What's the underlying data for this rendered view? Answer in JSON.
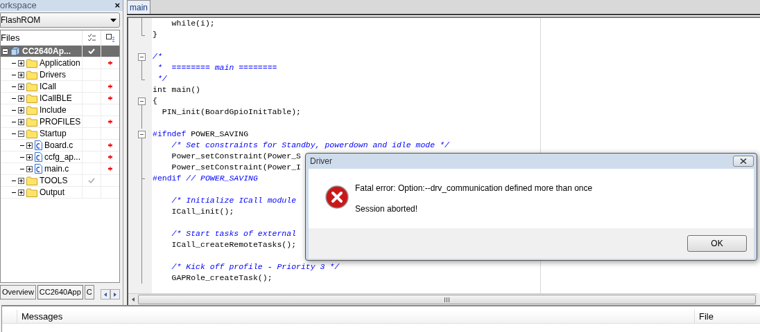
{
  "workspace": {
    "title": "orkspace",
    "close": "×",
    "configuration": "FlashROM",
    "columns": [
      "Files"
    ],
    "tree": [
      {
        "name": "CC2640Ap...",
        "kind": "project",
        "selected": true,
        "expanded": true,
        "check": true,
        "modified": false,
        "children": [
          {
            "name": "Application",
            "kind": "folder",
            "selected": false,
            "expanded": false,
            "check": false,
            "modified": true
          },
          {
            "name": "Drivers",
            "kind": "folder",
            "selected": false,
            "expanded": false,
            "check": false,
            "modified": false
          },
          {
            "name": "ICall",
            "kind": "folder",
            "selected": false,
            "expanded": false,
            "check": false,
            "modified": true
          },
          {
            "name": "ICallBLE",
            "kind": "folder",
            "selected": false,
            "expanded": false,
            "check": false,
            "modified": true
          },
          {
            "name": "Include",
            "kind": "folder",
            "selected": false,
            "expanded": false,
            "check": false,
            "modified": false
          },
          {
            "name": "PROFILES",
            "kind": "folder",
            "selected": false,
            "expanded": false,
            "check": false,
            "modified": true
          },
          {
            "name": "Startup",
            "kind": "folder",
            "selected": false,
            "expanded": true,
            "check": false,
            "modified": false,
            "children": [
              {
                "name": "Board.c",
                "kind": "file",
                "selected": false,
                "expanded": false,
                "check": false,
                "modified": true
              },
              {
                "name": "ccfg_ap...",
                "kind": "file",
                "selected": false,
                "expanded": false,
                "check": false,
                "modified": true
              },
              {
                "name": "main.c",
                "kind": "file",
                "selected": false,
                "expanded": false,
                "check": false,
                "modified": true
              }
            ]
          },
          {
            "name": "TOOLS",
            "kind": "folder",
            "selected": false,
            "expanded": false,
            "check": true,
            "modified": false
          },
          {
            "name": "Output",
            "kind": "folder",
            "selected": false,
            "expanded": false,
            "check": false,
            "modified": false
          }
        ]
      }
    ],
    "tabs": [
      {
        "label": "Overview",
        "selected": false
      },
      {
        "label": "CC2640App",
        "selected": true
      },
      {
        "label": "C",
        "selected": false
      }
    ]
  },
  "editor": {
    "tabs": [
      {
        "label": "main",
        "selected": true
      }
    ],
    "lines": [
      {
        "kind": "bar",
        "segments": [
          {
            "kind": "plain",
            "text": "    while(i);"
          }
        ]
      },
      {
        "kind": "end",
        "segments": [
          {
            "kind": "plain",
            "text": "}"
          }
        ]
      },
      {
        "kind": "none"
      },
      {
        "kind": "start",
        "segments": [
          {
            "kind": "comment",
            "text": "/*"
          }
        ]
      },
      {
        "kind": "bar",
        "segments": [
          {
            "kind": "comment",
            "text": " *  ======== main ========"
          }
        ]
      },
      {
        "kind": "end",
        "segments": [
          {
            "kind": "comment",
            "text": " */"
          }
        ]
      },
      {
        "kind": "none",
        "segments": [
          {
            "kind": "plain",
            "text": "int main()"
          }
        ]
      },
      {
        "kind": "start",
        "segments": [
          {
            "kind": "plain",
            "text": "{"
          }
        ]
      },
      {
        "kind": "bar",
        "segments": [
          {
            "kind": "plain",
            "text": "  PIN_init(BoardGpioInitTable);"
          }
        ]
      },
      {
        "kind": "bar"
      },
      {
        "kind": "start",
        "segments": [
          {
            "kind": "keyword",
            "text": "#ifndef"
          },
          {
            "kind": "plain",
            "text": " POWER_SAVING"
          }
        ]
      },
      {
        "kind": "bar",
        "segments": [
          {
            "kind": "comment",
            "text": "    /* Set constraints for Standby, powerdown and idle mode */"
          }
        ]
      },
      {
        "kind": "bar",
        "segments": [
          {
            "kind": "plain",
            "text": "    Power_setConstraint(Power_S"
          }
        ]
      },
      {
        "kind": "bar",
        "segments": [
          {
            "kind": "plain",
            "text": "    Power_setConstraint(Power_I"
          }
        ]
      },
      {
        "kind": "branch",
        "segments": [
          {
            "kind": "keyword",
            "text": "#endif"
          },
          {
            "kind": "comment",
            "text": " // POWER_SAVING"
          }
        ]
      },
      {
        "kind": "bar"
      },
      {
        "kind": "bar",
        "segments": [
          {
            "kind": "comment",
            "text": "    /* Initialize ICall module"
          }
        ]
      },
      {
        "kind": "bar",
        "segments": [
          {
            "kind": "plain",
            "text": "    ICall_init();"
          }
        ]
      },
      {
        "kind": "bar"
      },
      {
        "kind": "bar",
        "segments": [
          {
            "kind": "comment",
            "text": "    /* Start tasks of external"
          }
        ]
      },
      {
        "kind": "bar",
        "segments": [
          {
            "kind": "plain",
            "text": "    ICall_createRemoteTasks();"
          }
        ]
      },
      {
        "kind": "bar"
      },
      {
        "kind": "bar",
        "segments": [
          {
            "kind": "comment",
            "text": "    /* Kick off profile - Priority 3 */"
          }
        ]
      },
      {
        "kind": "bar",
        "segments": [
          {
            "kind": "plain",
            "text": "    GAPRole_createTask();"
          }
        ]
      }
    ]
  },
  "messages": {
    "columns": [
      "Messages",
      "File"
    ]
  },
  "dialog": {
    "title": "Driver",
    "lines": [
      "Fatal error: Option:--drv_communication defined more than once",
      "Session aborted!"
    ],
    "buttons": [
      "OK"
    ]
  }
}
